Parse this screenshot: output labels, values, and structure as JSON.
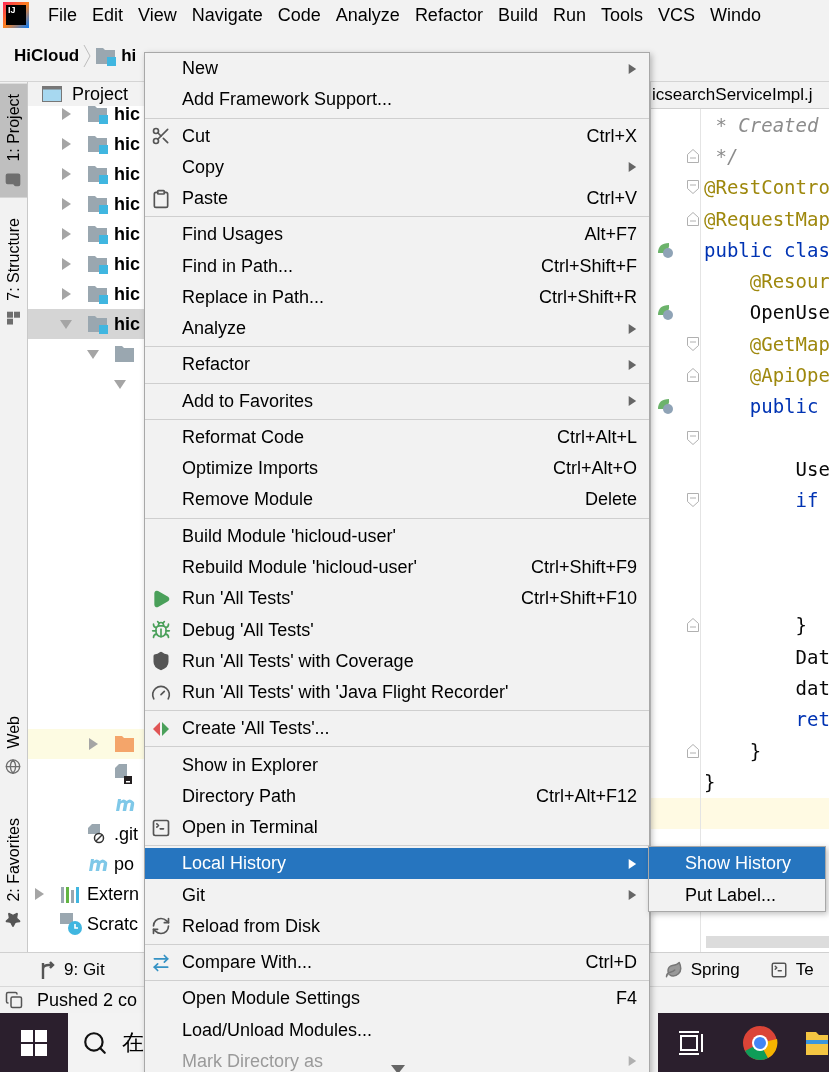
{
  "menubar": {
    "logo_text": "IJ",
    "items": [
      "File",
      "Edit",
      "View",
      "Navigate",
      "Code",
      "Analyze",
      "Refactor",
      "Build",
      "Run",
      "Tools",
      "VCS",
      "Windo"
    ]
  },
  "breadcrumb": [
    "HiCloud",
    "hi"
  ],
  "left_stripe": [
    {
      "label": "1: Project",
      "selected": true,
      "kind": "project"
    },
    {
      "label": "7: Structure",
      "selected": false,
      "kind": "structure"
    },
    {
      "label": "Web",
      "selected": false,
      "kind": "web"
    },
    {
      "label": "2: Favorites",
      "selected": false,
      "kind": "favorites"
    }
  ],
  "project_panel": {
    "title": "Project",
    "tree": [
      {
        "kind": "root",
        "children": [
          {
            "label": "hic",
            "kind": "module",
            "expanded": false,
            "selected": false,
            "highlighted": false
          },
          {
            "label": "hic",
            "kind": "module",
            "expanded": false,
            "selected": false,
            "highlighted": false
          },
          {
            "label": "hic",
            "kind": "module",
            "expanded": false,
            "selected": false,
            "highlighted": false
          },
          {
            "label": "hic",
            "kind": "module",
            "expanded": false,
            "selected": false,
            "highlighted": false
          },
          {
            "label": "hic",
            "kind": "module",
            "expanded": false,
            "selected": false,
            "highlighted": false
          },
          {
            "label": "hic",
            "kind": "module",
            "expanded": false,
            "selected": false,
            "highlighted": false
          },
          {
            "label": "hic",
            "kind": "module",
            "expanded": false,
            "selected": false,
            "highlighted": false
          },
          {
            "label": "hic",
            "kind": "module",
            "expanded": true,
            "selected": true,
            "highlighted": false,
            "children": [
              {
                "kind": "folder",
                "expanded": true,
                "selected": false,
                "highlighted": false,
                "children": [
                  {
                    "expanded": true,
                    "selected": false,
                    "highlighted": false
                  }
                ]
              },
              {
                "kind": "excluded-folder",
                "expanded": false,
                "selected": false,
                "highlighted": true
              },
              {
                "kind": "script",
                "selected": false,
                "highlighted": false
              },
              {
                "kind": "pom",
                "selected": false,
                "highlighted": false
              }
            ]
          },
          {
            "label": ".git",
            "kind": "ignore-file",
            "selected": false,
            "highlighted": false
          },
          {
            "label": "po",
            "kind": "pom",
            "selected": false,
            "highlighted": false
          }
        ]
      },
      {
        "label": "Extern",
        "kind": "libraries",
        "expanded": false,
        "selected": false,
        "highlighted": false
      },
      {
        "label": "Scratc",
        "kind": "scratches",
        "selected": false,
        "highlighted": false
      }
    ]
  },
  "editor": {
    "tab": "icsearchServiceImpl.j",
    "lines": [
      {
        "text": " * Created",
        "kind": "comment",
        "fold_start": false,
        "fold_end": false,
        "current": false
      },
      {
        "text": " */",
        "kind": "comment",
        "fold_start": false,
        "fold_end": true,
        "current": false
      },
      {
        "text": "@RestContro",
        "kind": "annotation",
        "fold_start": true,
        "fold_end": false,
        "current": false
      },
      {
        "text": "@RequestMap",
        "kind": "annotation",
        "fold_start": false,
        "fold_end": true,
        "current": false
      },
      {
        "text": "public clas",
        "kind": "keyword",
        "fold_start": false,
        "fold_end": false,
        "current": false
      },
      {
        "text": "    @Resour",
        "kind": "annotation",
        "fold_start": false,
        "fold_end": false,
        "current": false
      },
      {
        "text": "    OpenUse",
        "kind": "plain",
        "fold_start": false,
        "fold_end": false,
        "current": false
      },
      {
        "text": "    @GetMap",
        "kind": "annotation",
        "fold_start": true,
        "fold_end": false,
        "current": false
      },
      {
        "text": "    @ApiOpe",
        "kind": "annotation",
        "fold_start": false,
        "fold_end": true,
        "current": false
      },
      {
        "text": "    public",
        "kind": "keyword",
        "fold_start": false,
        "fold_end": false,
        "current": false
      },
      {
        "kind": "blank",
        "fold_start": true,
        "fold_end": false,
        "current": false
      },
      {
        "text": "        Use",
        "kind": "plain",
        "fold_start": false,
        "fold_end": false,
        "current": false
      },
      {
        "text": "        if",
        "kind": "keyword",
        "fold_start": true,
        "fold_end": false,
        "current": false
      },
      {
        "kind": "blank",
        "fold_start": false,
        "fold_end": false,
        "current": false
      },
      {
        "kind": "blank",
        "fold_start": false,
        "fold_end": false,
        "current": false
      },
      {
        "kind": "blank",
        "fold_start": false,
        "fold_end": false,
        "current": false
      },
      {
        "text": "        }",
        "kind": "plain",
        "fold_start": false,
        "fold_end": true,
        "current": false
      },
      {
        "text": "        Dat",
        "kind": "plain",
        "fold_start": false,
        "fold_end": false,
        "current": false
      },
      {
        "text": "        dat",
        "kind": "plain",
        "fold_start": false,
        "fold_end": false,
        "current": false
      },
      {
        "text": "        ret",
        "kind": "keyword",
        "fold_start": false,
        "fold_end": false,
        "current": false
      },
      {
        "text": "    }",
        "kind": "plain",
        "fold_start": false,
        "fold_end": true,
        "current": false
      },
      {
        "text": "}",
        "kind": "plain",
        "fold_start": false,
        "fold_end": false,
        "current": false
      },
      {
        "kind": "blank",
        "fold_start": false,
        "fold_end": false,
        "current": true
      }
    ]
  },
  "tool_bar": [
    {
      "label": "9: Git",
      "kind": "git"
    },
    {
      "label": "Spring",
      "kind": "spring"
    },
    {
      "label": "Te",
      "kind": "terminal"
    }
  ],
  "status_bar": "Pushed 2 co",
  "taskbar": {
    "search_text": "在"
  },
  "context_menu": {
    "groups": [
      {
        "items": [
          {
            "label": "New",
            "submenu": true,
            "selected": false,
            "disabled": false
          },
          {
            "label": "Add Framework Support...",
            "submenu": false,
            "selected": false,
            "disabled": false
          }
        ]
      },
      {
        "items": [
          {
            "label": "Cut",
            "shortcut": "Ctrl+X",
            "submenu": false,
            "selected": false,
            "disabled": false
          },
          {
            "label": "Copy",
            "submenu": true,
            "selected": false,
            "disabled": false
          },
          {
            "label": "Paste",
            "shortcut": "Ctrl+V",
            "submenu": false,
            "selected": false,
            "disabled": false
          }
        ]
      },
      {
        "items": [
          {
            "label": "Find Usages",
            "shortcut": "Alt+F7",
            "submenu": false,
            "selected": false,
            "disabled": false
          },
          {
            "label": "Find in Path...",
            "shortcut": "Ctrl+Shift+F",
            "submenu": false,
            "selected": false,
            "disabled": false
          },
          {
            "label": "Replace in Path...",
            "shortcut": "Ctrl+Shift+R",
            "submenu": false,
            "selected": false,
            "disabled": false
          },
          {
            "label": "Analyze",
            "submenu": true,
            "selected": false,
            "disabled": false
          }
        ]
      },
      {
        "items": [
          {
            "label": "Refactor",
            "submenu": true,
            "selected": false,
            "disabled": false
          }
        ]
      },
      {
        "items": [
          {
            "label": "Add to Favorites",
            "submenu": true,
            "selected": false,
            "disabled": false
          }
        ]
      },
      {
        "items": [
          {
            "label": "Reformat Code",
            "shortcut": "Ctrl+Alt+L",
            "submenu": false,
            "selected": false,
            "disabled": false
          },
          {
            "label": "Optimize Imports",
            "shortcut": "Ctrl+Alt+O",
            "submenu": false,
            "selected": false,
            "disabled": false
          },
          {
            "label": "Remove Module",
            "shortcut": "Delete",
            "submenu": false,
            "selected": false,
            "disabled": false
          }
        ]
      },
      {
        "items": [
          {
            "label": "Build Module 'hicloud-user'",
            "submenu": false,
            "selected": false,
            "disabled": false
          },
          {
            "label": "Rebuild Module 'hicloud-user'",
            "shortcut": "Ctrl+Shift+F9",
            "submenu": false,
            "selected": false,
            "disabled": false
          },
          {
            "label": "Run 'All Tests'",
            "shortcut": "Ctrl+Shift+F10",
            "submenu": false,
            "selected": false,
            "disabled": false
          },
          {
            "label": "Debug 'All Tests'",
            "submenu": false,
            "selected": false,
            "disabled": false
          },
          {
            "label": "Run 'All Tests' with Coverage",
            "submenu": false,
            "selected": false,
            "disabled": false
          },
          {
            "label": "Run 'All Tests' with 'Java Flight Recorder'",
            "submenu": false,
            "selected": false,
            "disabled": false
          }
        ]
      },
      {
        "items": [
          {
            "label": "Create 'All Tests'...",
            "submenu": false,
            "selected": false,
            "disabled": false
          }
        ]
      },
      {
        "items": [
          {
            "label": "Show in Explorer",
            "submenu": false,
            "selected": false,
            "disabled": false
          },
          {
            "label": "Directory Path",
            "shortcut": "Ctrl+Alt+F12",
            "submenu": false,
            "selected": false,
            "disabled": false
          },
          {
            "label": "Open in Terminal",
            "submenu": false,
            "selected": false,
            "disabled": false
          }
        ]
      },
      {
        "items": [
          {
            "label": "Local History",
            "submenu": true,
            "selected": true,
            "disabled": false
          },
          {
            "label": "Git",
            "submenu": true,
            "selected": false,
            "disabled": false
          },
          {
            "label": "Reload from Disk",
            "submenu": false,
            "selected": false,
            "disabled": false
          }
        ]
      },
      {
        "items": [
          {
            "label": "Compare With...",
            "shortcut": "Ctrl+D",
            "submenu": false,
            "selected": false,
            "disabled": false
          }
        ]
      },
      {
        "items": [
          {
            "label": "Open Module Settings",
            "shortcut": "F4",
            "submenu": false,
            "selected": false,
            "disabled": false
          },
          {
            "label": "Load/Unload Modules...",
            "submenu": false,
            "selected": false,
            "disabled": false
          },
          {
            "label": "Mark Directory as",
            "submenu": true,
            "selected": false,
            "disabled": true
          }
        ]
      }
    ]
  },
  "submenu": {
    "items": [
      {
        "label": "Show History",
        "selected": true
      },
      {
        "label": "Put Label...",
        "selected": false
      }
    ]
  }
}
